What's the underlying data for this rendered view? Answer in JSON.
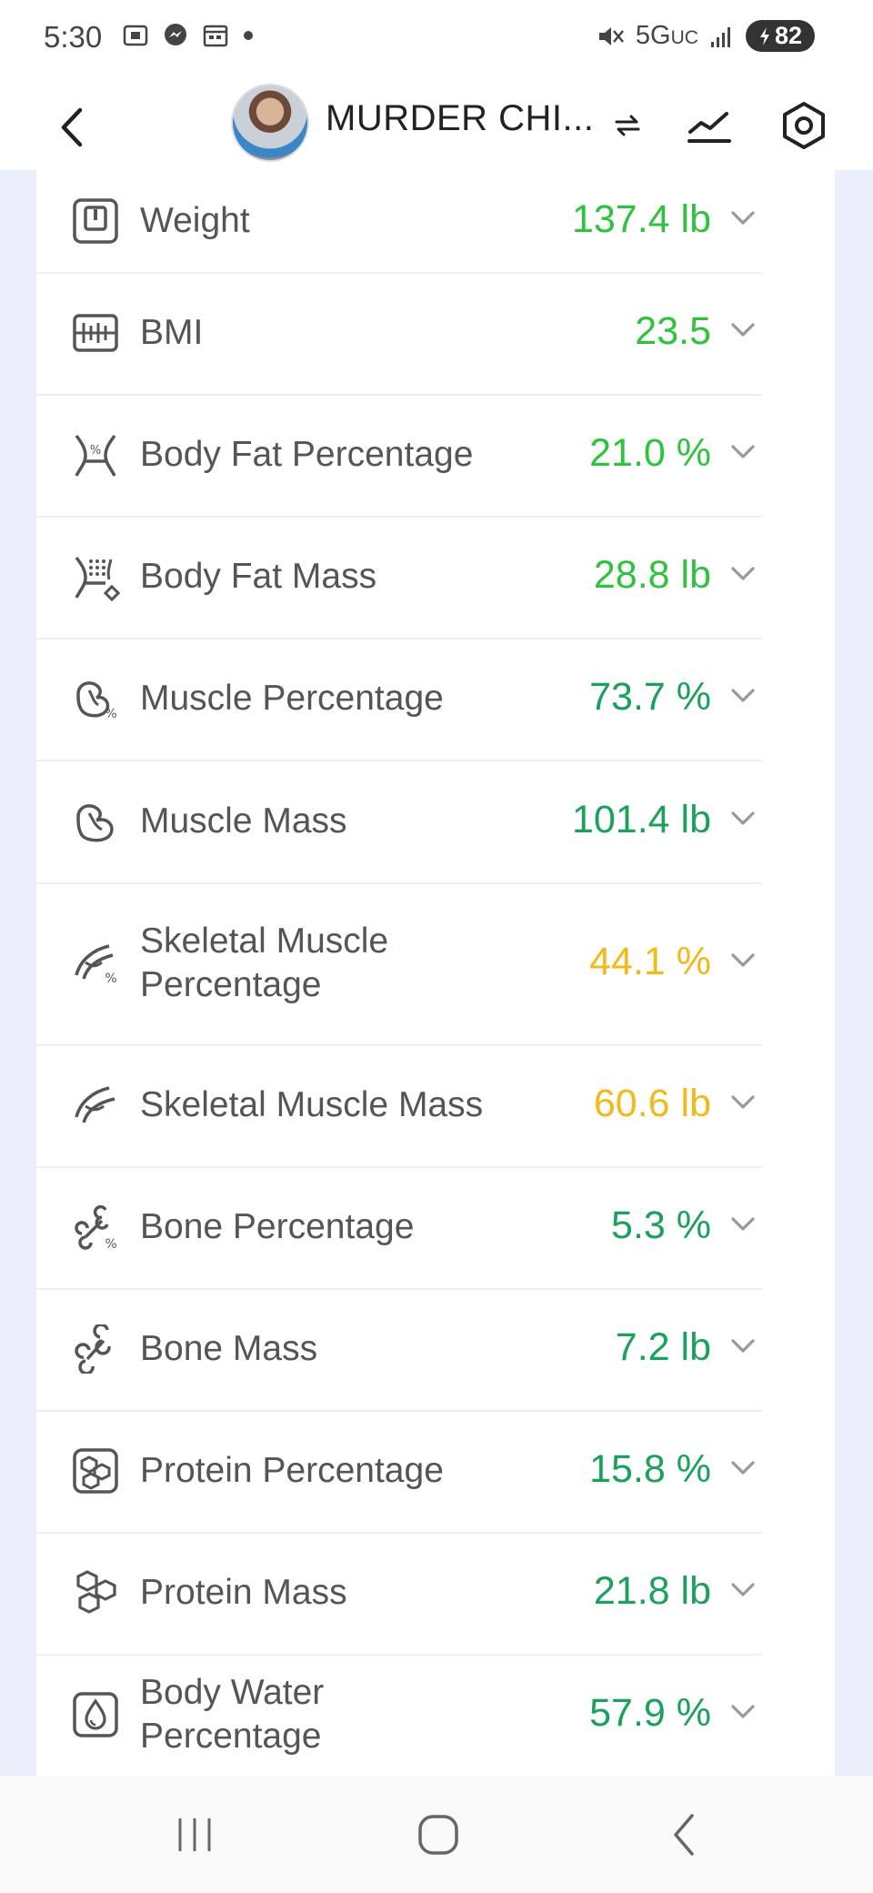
{
  "status_bar": {
    "time": "5:30",
    "network": "5G",
    "network_suffix": "UC",
    "battery": "82"
  },
  "header": {
    "title": "MURDER CHI..."
  },
  "colors": {
    "green_bright": "#2fc23f",
    "green_teal": "#1aa15c",
    "amber": "#f3b81a",
    "muted": "#555555"
  },
  "metrics": [
    {
      "label": "Weight",
      "value": "137.4 lb",
      "icon": "scale-icon",
      "color": "#2fc23f"
    },
    {
      "label": "BMI",
      "value": "23.5",
      "icon": "ruler-icon",
      "color": "#2fc23f"
    },
    {
      "label": "Body Fat Percentage",
      "value": "21.0 %",
      "icon": "body-fat-percent-icon",
      "color": "#2fc23f"
    },
    {
      "label": "Body Fat Mass",
      "value": "28.8 lb",
      "icon": "body-fat-mass-icon",
      "color": "#2fc23f"
    },
    {
      "label": "Muscle Percentage",
      "value": "73.7 %",
      "icon": "muscle-percent-icon",
      "color": "#1aa15c"
    },
    {
      "label": "Muscle Mass",
      "value": "101.4 lb",
      "icon": "muscle-mass-icon",
      "color": "#1aa15c"
    },
    {
      "label": "Skeletal Muscle Percentage",
      "value": "44.1 %",
      "icon": "skeletal-muscle-percent-icon",
      "color": "#f3b81a"
    },
    {
      "label": "Skeletal Muscle Mass",
      "value": "60.6 lb",
      "icon": "skeletal-muscle-mass-icon",
      "color": "#f3b81a"
    },
    {
      "label": "Bone Percentage",
      "value": "5.3 %",
      "icon": "bone-percent-icon",
      "color": "#1aa15c"
    },
    {
      "label": "Bone Mass",
      "value": "7.2 lb",
      "icon": "bone-icon",
      "color": "#1aa15c"
    },
    {
      "label": "Protein Percentage",
      "value": "15.8 %",
      "icon": "protein-percent-icon",
      "color": "#1aa15c"
    },
    {
      "label": "Protein Mass",
      "value": "21.8 lb",
      "icon": "protein-mass-icon",
      "color": "#1aa15c"
    },
    {
      "label": "Body Water Percentage",
      "value": "57.9 %",
      "icon": "water-drop-icon",
      "color": "#1aa15c"
    }
  ]
}
